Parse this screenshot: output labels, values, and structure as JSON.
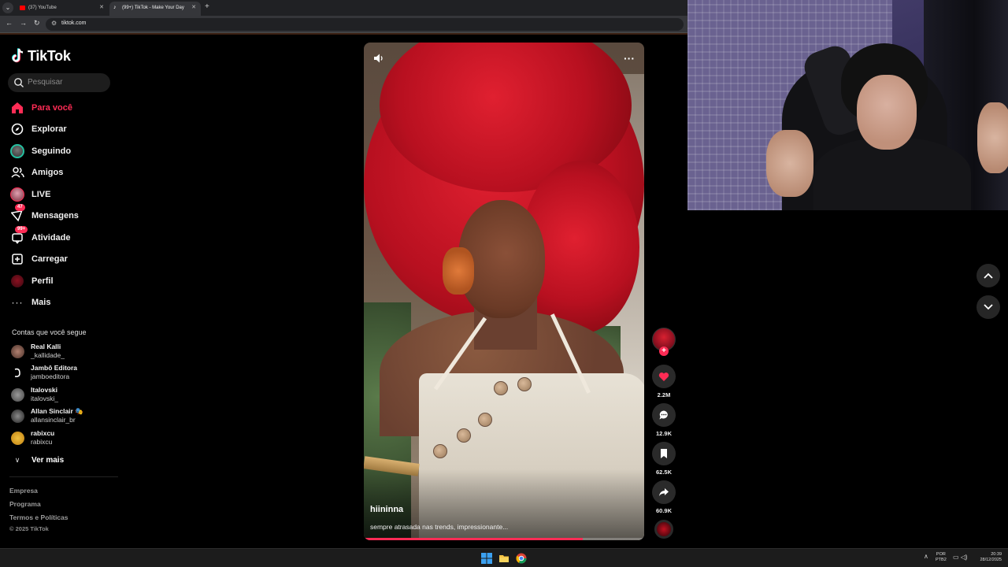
{
  "browser": {
    "tabs": [
      {
        "label": "(37) YouTube",
        "favicon_color": "#ff0000"
      },
      {
        "label": "(99+) TikTok - Make Your Day",
        "favicon_color": "#ffffff"
      }
    ],
    "url": "tiktok.com"
  },
  "app": {
    "logo_text": "TikTok",
    "accent_color": "#fe2c55"
  },
  "search": {
    "placeholder": "Pesquisar"
  },
  "nav": {
    "items": [
      {
        "label": "Para você",
        "icon": "home-icon",
        "active": true
      },
      {
        "label": "Explorar",
        "icon": "compass-icon"
      },
      {
        "label": "Seguindo",
        "icon": "following-icon"
      },
      {
        "label": "Amigos",
        "icon": "friends-icon"
      },
      {
        "label": "LIVE",
        "icon": "live-icon"
      },
      {
        "label": "Mensagens",
        "icon": "messages-icon",
        "badge": "47"
      },
      {
        "label": "Atividade",
        "icon": "activity-icon",
        "badge": "99+"
      },
      {
        "label": "Carregar",
        "icon": "upload-icon"
      },
      {
        "label": "Perfil",
        "icon": "profile-icon"
      },
      {
        "label": "Mais",
        "icon": "more-icon"
      }
    ]
  },
  "following": {
    "title": "Contas que você segue",
    "accounts": [
      {
        "name": "Real Kalli",
        "handle": "_kallidade_"
      },
      {
        "name": "Jambô Editora",
        "handle": "jamboeditora"
      },
      {
        "name": "Italovski",
        "handle": "italovski_"
      },
      {
        "name": "Allan Sinclair 🎭",
        "handle": "allansinclair_br"
      },
      {
        "name": "rabixcu",
        "handle": "rabixcu"
      }
    ],
    "see_more": "Ver mais"
  },
  "footer": {
    "links": [
      "Empresa",
      "Programa",
      "Termos e Políticas"
    ],
    "copyright": "© 2025 TikTok"
  },
  "video": {
    "author": "hiininna",
    "caption": "sempre atrasada nas trends, impressionante...",
    "progress": 0.78
  },
  "actions": {
    "likes": "2.2M",
    "comments": "12.9K",
    "saves": "62.5K",
    "shares": "60.9K"
  },
  "taskbar": {
    "lang_line1": "POR",
    "lang_line2": "PTB2",
    "time": "20:39",
    "date": "28/12/2025"
  }
}
